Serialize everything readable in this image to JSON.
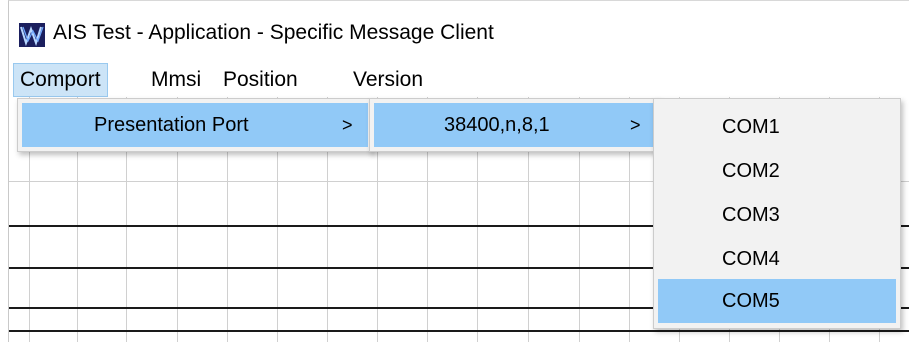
{
  "window": {
    "title": "AIS Test - Application - Specific Message Client",
    "icon": "app-logo-icon"
  },
  "menubar": {
    "items": [
      {
        "label": "Comport",
        "active": true
      },
      {
        "label": "Mmsi",
        "active": false
      },
      {
        "label": "Position",
        "active": false
      },
      {
        "label": "Version",
        "active": false
      }
    ]
  },
  "comport_menu": {
    "items": [
      {
        "label": "Presentation Port",
        "arrow": ">",
        "highlighted": true
      }
    ]
  },
  "presentation_port_menu": {
    "items": [
      {
        "label": "38400,n,8,1",
        "arrow": ">",
        "highlighted": true
      }
    ]
  },
  "port_menu": {
    "items": [
      {
        "label": "COM1",
        "highlighted": false
      },
      {
        "label": "COM2",
        "highlighted": false
      },
      {
        "label": "COM3",
        "highlighted": false
      },
      {
        "label": "COM4",
        "highlighted": false
      },
      {
        "label": "COM5",
        "highlighted": true
      }
    ]
  },
  "colors": {
    "menu_highlight": "#91c9f7",
    "menubar_active": "#cce4f7",
    "popup_background": "#f2f2f2",
    "grid_line": "#d0d0d0"
  }
}
